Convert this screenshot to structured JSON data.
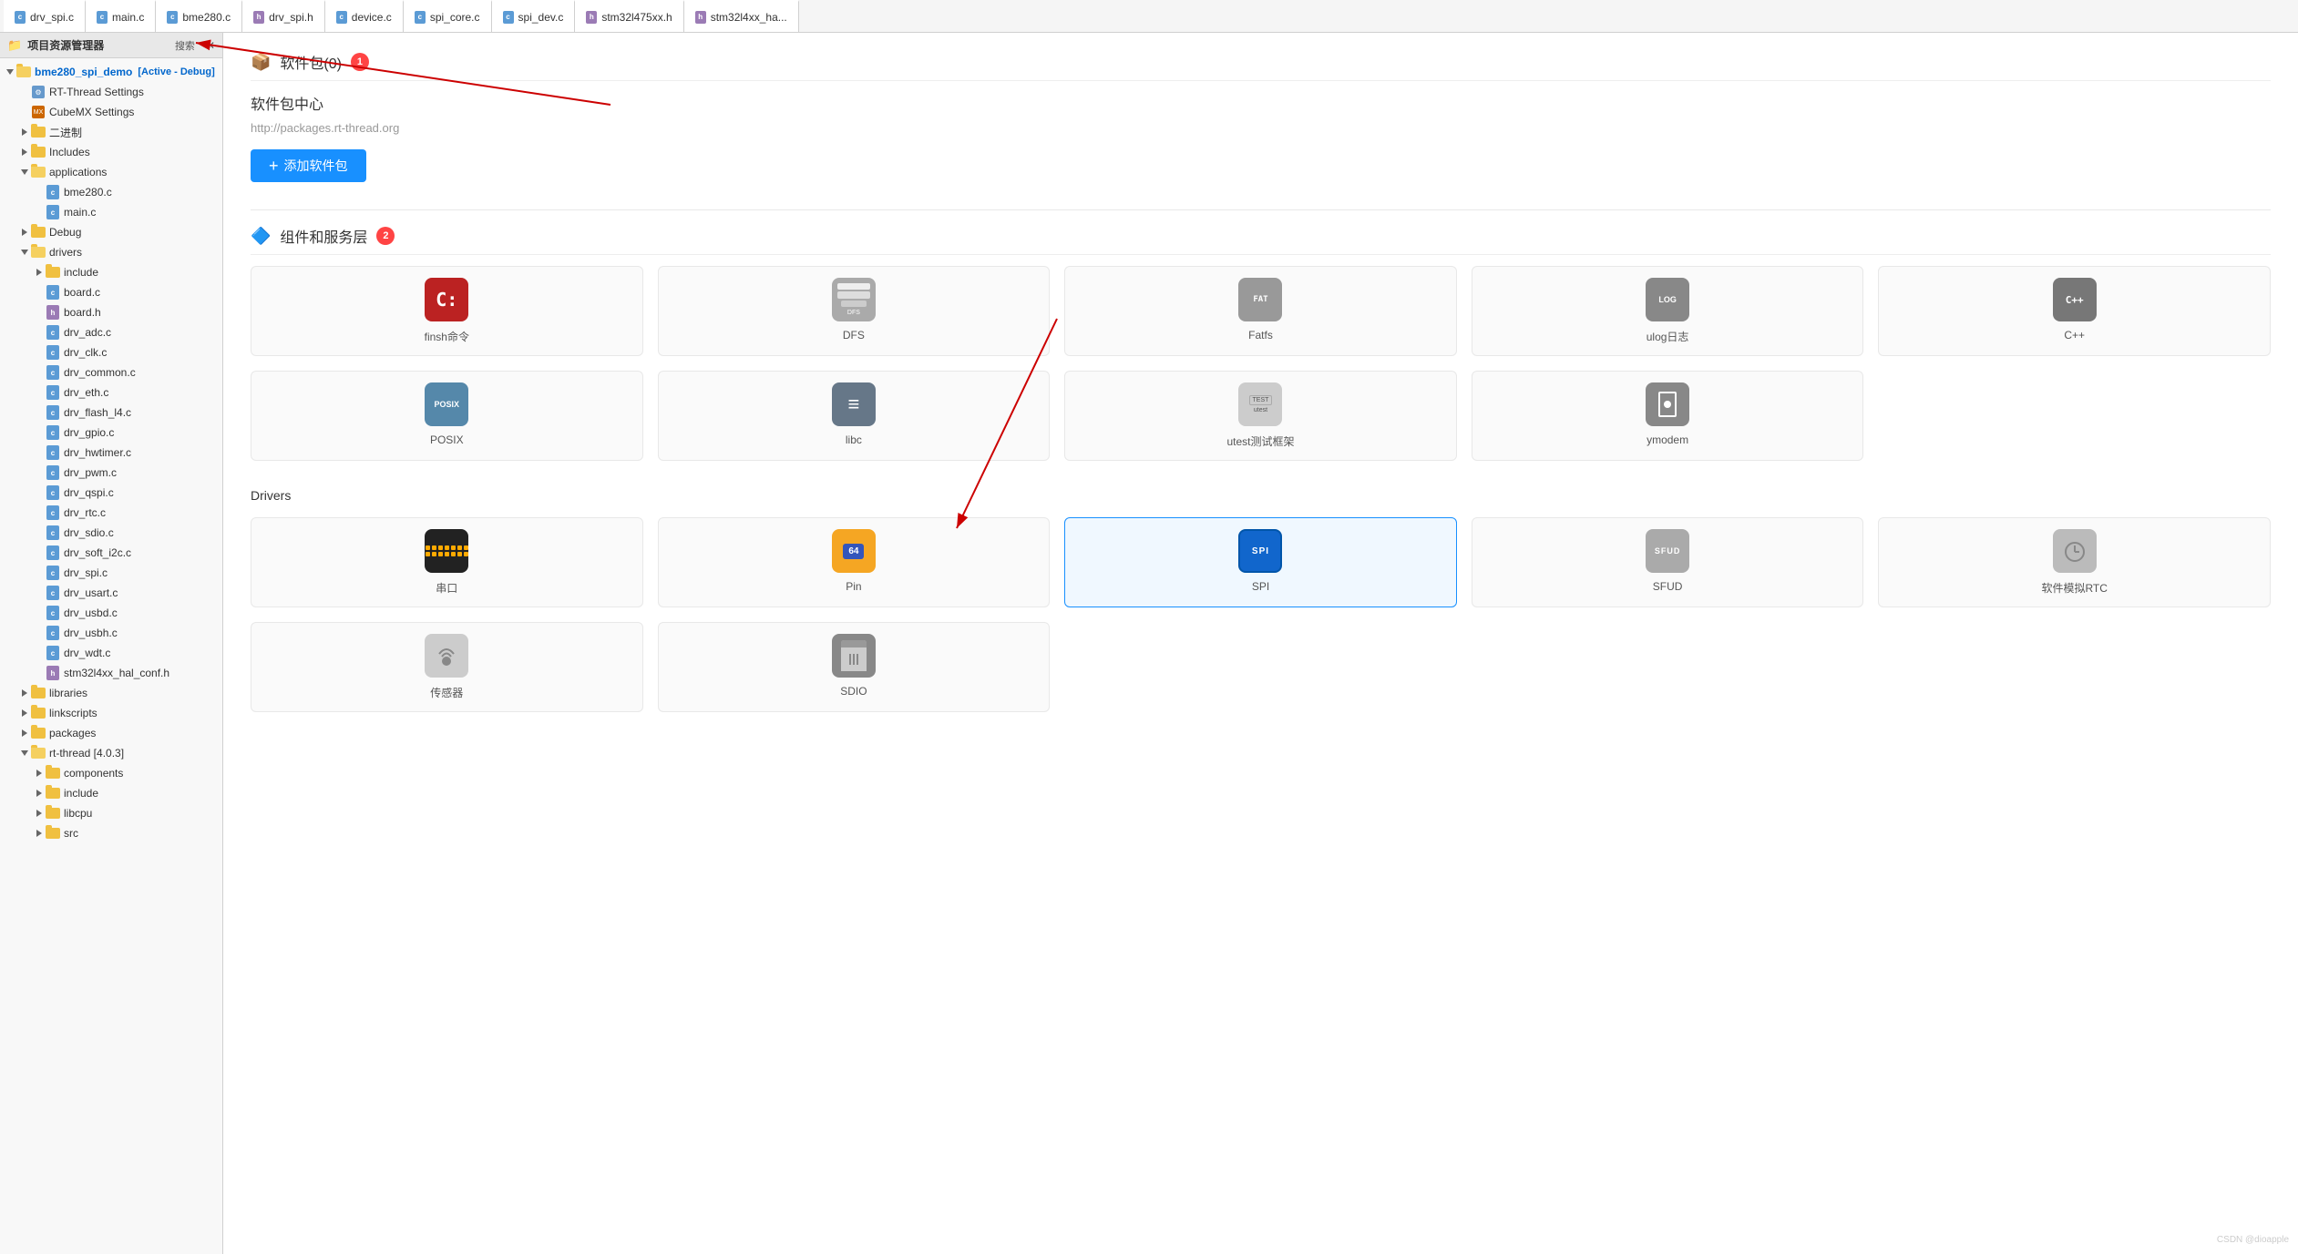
{
  "tabs": [
    {
      "label": "drv_spi.c",
      "type": "c"
    },
    {
      "label": "main.c",
      "type": "c"
    },
    {
      "label": "bme280.c",
      "type": "c"
    },
    {
      "label": "drv_spi.h",
      "type": "h"
    },
    {
      "label": "device.c",
      "type": "c"
    },
    {
      "label": "spi_core.c",
      "type": "c"
    },
    {
      "label": "spi_dev.c",
      "type": "c"
    },
    {
      "label": "stm32l475xx.h",
      "type": "h"
    },
    {
      "label": "stm32l4xx_ha...",
      "type": "h"
    }
  ],
  "sidebar": {
    "title": "项目资源管理器",
    "search_label": "搜索",
    "project_name": "bme280_spi_demo",
    "project_badge": "[Active - Debug]",
    "items": [
      {
        "id": "rt-thread-settings",
        "label": "RT-Thread Settings",
        "type": "settings",
        "depth": 1,
        "arrow": "none"
      },
      {
        "id": "cubemx-settings",
        "label": "CubeMX Settings",
        "type": "mx",
        "depth": 1,
        "arrow": "none"
      },
      {
        "id": "binary",
        "label": "二进制",
        "type": "folder",
        "depth": 1,
        "arrow": "right"
      },
      {
        "id": "includes",
        "label": "Includes",
        "type": "folder",
        "depth": 1,
        "arrow": "right"
      },
      {
        "id": "applications",
        "label": "applications",
        "type": "folder-open",
        "depth": 1,
        "arrow": "down"
      },
      {
        "id": "bme280c",
        "label": "bme280.c",
        "type": "c",
        "depth": 2,
        "arrow": "none"
      },
      {
        "id": "mainc",
        "label": "main.c",
        "type": "c",
        "depth": 2,
        "arrow": "none"
      },
      {
        "id": "debug",
        "label": "Debug",
        "type": "folder",
        "depth": 1,
        "arrow": "right"
      },
      {
        "id": "drivers",
        "label": "drivers",
        "type": "folder-open",
        "depth": 1,
        "arrow": "down"
      },
      {
        "id": "include",
        "label": "include",
        "type": "folder",
        "depth": 2,
        "arrow": "right"
      },
      {
        "id": "boardc",
        "label": "board.c",
        "type": "c",
        "depth": 2,
        "arrow": "none"
      },
      {
        "id": "boardh",
        "label": "board.h",
        "type": "h",
        "depth": 2,
        "arrow": "none"
      },
      {
        "id": "drv_adcc",
        "label": "drv_adc.c",
        "type": "c",
        "depth": 2,
        "arrow": "none"
      },
      {
        "id": "drv_clkc",
        "label": "drv_clk.c",
        "type": "c",
        "depth": 2,
        "arrow": "none"
      },
      {
        "id": "drv_commonc",
        "label": "drv_common.c",
        "type": "c",
        "depth": 2,
        "arrow": "none"
      },
      {
        "id": "drv_ethc",
        "label": "drv_eth.c",
        "type": "c",
        "depth": 2,
        "arrow": "none"
      },
      {
        "id": "drv_flash_l4c",
        "label": "drv_flash_l4.c",
        "type": "c",
        "depth": 2,
        "arrow": "none"
      },
      {
        "id": "drv_gpioc",
        "label": "drv_gpio.c",
        "type": "c",
        "depth": 2,
        "arrow": "none"
      },
      {
        "id": "drv_hwtimerc",
        "label": "drv_hwtimer.c",
        "type": "c",
        "depth": 2,
        "arrow": "none"
      },
      {
        "id": "drv_pwmc",
        "label": "drv_pwm.c",
        "type": "c",
        "depth": 2,
        "arrow": "none"
      },
      {
        "id": "drv_qspic",
        "label": "drv_qspi.c",
        "type": "c",
        "depth": 2,
        "arrow": "none"
      },
      {
        "id": "drv_rtcc",
        "label": "drv_rtc.c",
        "type": "c",
        "depth": 2,
        "arrow": "none"
      },
      {
        "id": "drv_sdioc",
        "label": "drv_sdio.c",
        "type": "c",
        "depth": 2,
        "arrow": "none"
      },
      {
        "id": "drv_soft_i2cc",
        "label": "drv_soft_i2c.c",
        "type": "c",
        "depth": 2,
        "arrow": "none"
      },
      {
        "id": "drv_spic",
        "label": "drv_spi.c",
        "type": "c",
        "depth": 2,
        "arrow": "none"
      },
      {
        "id": "drv_usartc",
        "label": "drv_usart.c",
        "type": "c",
        "depth": 2,
        "arrow": "none"
      },
      {
        "id": "drv_usbdc",
        "label": "drv_usbd.c",
        "type": "c",
        "depth": 2,
        "arrow": "none"
      },
      {
        "id": "drv_usbhc",
        "label": "drv_usbh.c",
        "type": "c",
        "depth": 2,
        "arrow": "none"
      },
      {
        "id": "drv_wdtc",
        "label": "drv_wdt.c",
        "type": "c",
        "depth": 2,
        "arrow": "none"
      },
      {
        "id": "stm32l4xx_hal_conf",
        "label": "stm32l4xx_hal_conf.h",
        "type": "h",
        "depth": 2,
        "arrow": "none"
      },
      {
        "id": "libraries",
        "label": "libraries",
        "type": "folder",
        "depth": 1,
        "arrow": "right"
      },
      {
        "id": "linkscripts",
        "label": "linkscripts",
        "type": "folder",
        "depth": 1,
        "arrow": "right"
      },
      {
        "id": "packages",
        "label": "packages",
        "type": "folder",
        "depth": 1,
        "arrow": "right"
      },
      {
        "id": "rt-thread",
        "label": "rt-thread [4.0.3]",
        "type": "folder-open",
        "depth": 1,
        "arrow": "down"
      },
      {
        "id": "components",
        "label": "components",
        "type": "folder",
        "depth": 2,
        "arrow": "right"
      },
      {
        "id": "rt-include",
        "label": "include",
        "type": "folder",
        "depth": 2,
        "arrow": "right"
      },
      {
        "id": "libcpu",
        "label": "libcpu",
        "type": "folder",
        "depth": 2,
        "arrow": "right"
      },
      {
        "id": "src",
        "label": "src",
        "type": "folder",
        "depth": 2,
        "arrow": "right"
      }
    ]
  },
  "content": {
    "pkg_section": {
      "title": "软件包(0)",
      "badge": "1",
      "center_title": "软件包中心",
      "url": "http://packages.rt-thread.org",
      "add_btn_label": "添加软件包"
    },
    "components_section": {
      "title": "组件和服务层",
      "badge": "2",
      "items": [
        {
          "id": "finsh",
          "label": "finsh命令",
          "icon_type": "finsh"
        },
        {
          "id": "dfs",
          "label": "DFS",
          "icon_type": "dfs"
        },
        {
          "id": "fatfs",
          "label": "Fatfs",
          "icon_type": "fatfs"
        },
        {
          "id": "ulog",
          "label": "ulog日志",
          "icon_type": "ulog"
        },
        {
          "id": "cpp",
          "label": "C++",
          "icon_type": "cpp"
        },
        {
          "id": "posix",
          "label": "POSIX",
          "icon_type": "posix"
        },
        {
          "id": "libc",
          "label": "libc",
          "icon_type": "libc"
        },
        {
          "id": "utest",
          "label": "utest测试框架",
          "icon_type": "utest"
        },
        {
          "id": "ymodem",
          "label": "ymodem",
          "icon_type": "ymodem"
        }
      ]
    },
    "drivers_section": {
      "title": "Drivers",
      "items": [
        {
          "id": "serial",
          "label": "串口",
          "icon_type": "serial"
        },
        {
          "id": "pin",
          "label": "Pin",
          "icon_type": "pin"
        },
        {
          "id": "spi",
          "label": "SPI",
          "icon_type": "spi",
          "highlighted": true
        },
        {
          "id": "sfud",
          "label": "SFUD",
          "icon_type": "sfud"
        },
        {
          "id": "rtc-soft",
          "label": "软件模拟RTC",
          "icon_type": "rtc"
        },
        {
          "id": "sensor",
          "label": "传感器",
          "icon_type": "sensor"
        },
        {
          "id": "sdio",
          "label": "SDIO",
          "icon_type": "sdio"
        }
      ]
    }
  }
}
